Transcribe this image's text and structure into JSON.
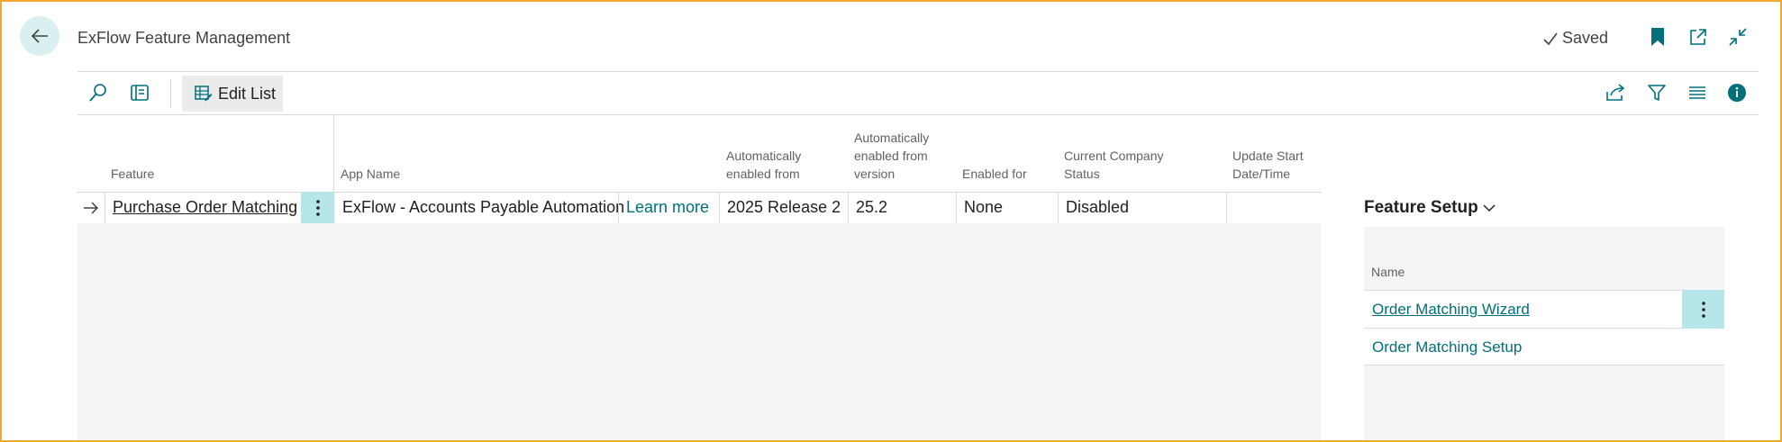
{
  "header": {
    "title": "ExFlow Feature Management",
    "saved_label": "Saved"
  },
  "toolbar": {
    "edit_list_label": "Edit List"
  },
  "table": {
    "columns": [
      {
        "key": "feature",
        "label": "Feature"
      },
      {
        "key": "app_name",
        "label": "App Name"
      },
      {
        "key": "auto_from",
        "label": "Automatically enabled from"
      },
      {
        "key": "auto_version",
        "label": "Automatically enabled from version"
      },
      {
        "key": "enabled_for",
        "label": "Enabled for"
      },
      {
        "key": "company_status",
        "label": "Current Company Status"
      },
      {
        "key": "update_start",
        "label": "Update Start Date/Time"
      }
    ],
    "rows": [
      {
        "feature": "Purchase Order Matching",
        "app_name": "ExFlow - Accounts Payable Automation",
        "learn_more": "Learn more",
        "auto_from": "2025 Release 2",
        "auto_version": "25.2",
        "enabled_for": "None",
        "company_status": "Disabled",
        "update_start": ""
      }
    ]
  },
  "factbox": {
    "title": "Feature Setup",
    "column_header": "Name",
    "items": [
      "Order Matching Wizard",
      "Order Matching Setup"
    ]
  },
  "colors": {
    "accent": "#00707a",
    "back_button_bg": "#d9eff0",
    "selected_menu_bg": "#b6e6ea",
    "frame_border": "#f0a92e",
    "grid_empty_bg": "#f4f5f6"
  },
  "icons": [
    "back-arrow-icon",
    "checkmark-icon",
    "bookmark-icon",
    "popout-icon",
    "collapse-icon",
    "search-icon",
    "filter-pane-icon",
    "edit-list-icon",
    "share-icon",
    "filter-icon",
    "list-view-icon",
    "info-icon",
    "row-arrow-icon",
    "ellipsis-icon",
    "chevron-down-icon"
  ]
}
